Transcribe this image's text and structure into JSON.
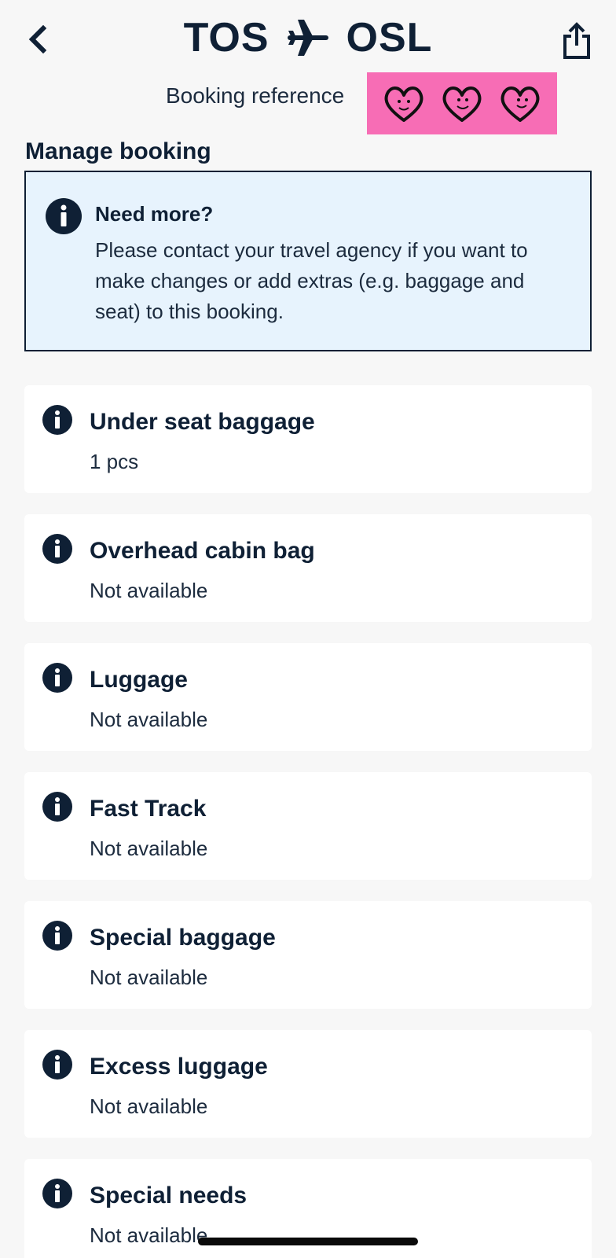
{
  "header": {
    "origin": "TOS",
    "destination": "OSL",
    "booking_reference_label": "Booking reference"
  },
  "icons": {
    "back": "chevron-left-icon",
    "share": "share-icon",
    "route": "airplane-icon",
    "info": "info-icon",
    "redaction": "heart-doodle-icon"
  },
  "colors": {
    "navy": "#0f2035",
    "redaction_pink": "#f76db5",
    "notice_bg": "#e7f3fd",
    "page_bg": "#f7f7f7"
  },
  "manage_booking": {
    "title": "Manage booking",
    "notice_title": "Need more?",
    "notice_body": "Please contact your travel agency if you want to make changes or add extras (e.g. baggage and seat) to this booking."
  },
  "extras": [
    {
      "title": "Under seat baggage",
      "value": "1 pcs"
    },
    {
      "title": "Overhead cabin bag",
      "value": "Not available"
    },
    {
      "title": "Luggage",
      "value": "Not available"
    },
    {
      "title": "Fast Track",
      "value": "Not available"
    },
    {
      "title": "Special baggage",
      "value": "Not available"
    },
    {
      "title": "Excess luggage",
      "value": "Not available"
    },
    {
      "title": "Special needs",
      "value": "Not available"
    }
  ]
}
